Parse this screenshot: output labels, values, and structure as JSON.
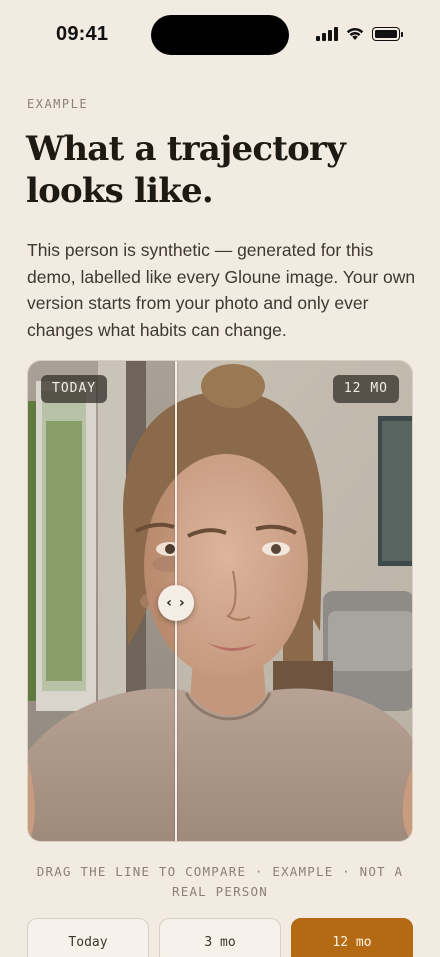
{
  "status_bar": {
    "time": "09:41"
  },
  "eyebrow": "EXAMPLE",
  "headline": "What a trajectory looks like.",
  "body": "This person is synthetic — generated for this demo, labelled like every Gloune image. Your own version starts from your photo and only ever changes what habits can change.",
  "compare": {
    "left_label": "TODAY",
    "right_label": "12 MO",
    "handle_glyph": "‹ ›",
    "position": 0.38
  },
  "hint": "DRAG THE LINE TO COMPARE · EXAMPLE · NOT A REAL PERSON",
  "segments": [
    {
      "label": "Today",
      "active": false
    },
    {
      "label": "3 mo",
      "active": false
    },
    {
      "label": "12 mo",
      "active": true
    }
  ],
  "colors": {
    "background": "#f1ebe2",
    "accent": "#b36a12",
    "muted_text": "#8b8176"
  }
}
